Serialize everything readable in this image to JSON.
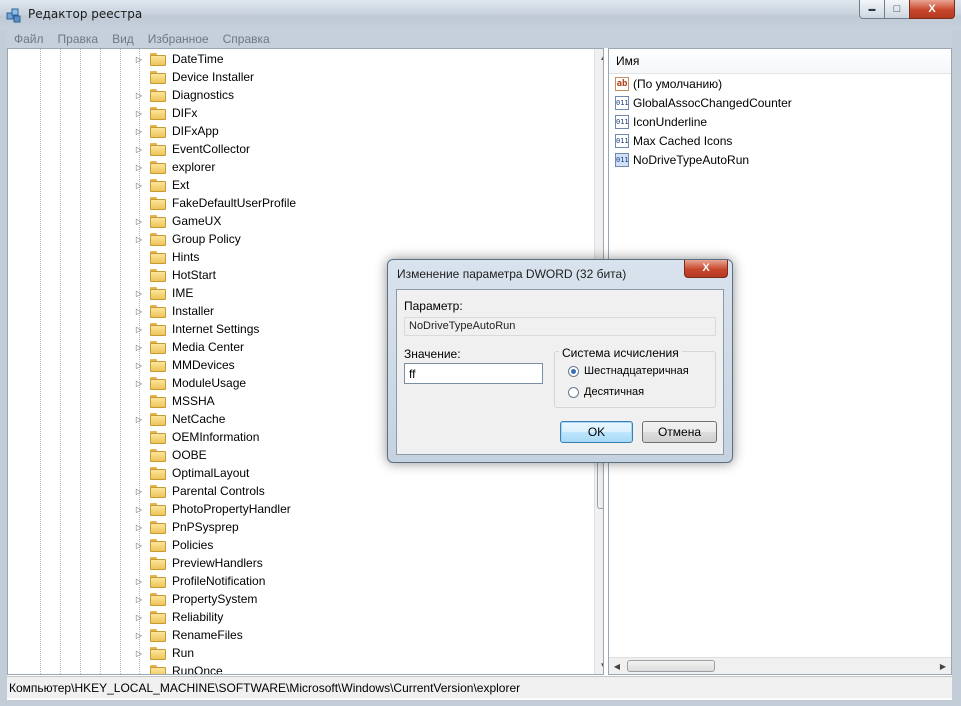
{
  "window": {
    "title": "Редактор реестра",
    "controls": {
      "minimize": "▬",
      "maximize": "□",
      "close": "X"
    }
  },
  "menu": [
    "Файл",
    "Правка",
    "Вид",
    "Избранное",
    "Справка"
  ],
  "tree": {
    "items": [
      {
        "label": "DateTime",
        "expandable": true
      },
      {
        "label": "Device Installer",
        "expandable": false
      },
      {
        "label": "Diagnostics",
        "expandable": true
      },
      {
        "label": "DIFx",
        "expandable": true
      },
      {
        "label": "DIFxApp",
        "expandable": true
      },
      {
        "label": "EventCollector",
        "expandable": true
      },
      {
        "label": "explorer",
        "expandable": true
      },
      {
        "label": "Ext",
        "expandable": true
      },
      {
        "label": "FakeDefaultUserProfile",
        "expandable": false
      },
      {
        "label": "GameUX",
        "expandable": true
      },
      {
        "label": "Group Policy",
        "expandable": true
      },
      {
        "label": "Hints",
        "expandable": false
      },
      {
        "label": "HotStart",
        "expandable": false
      },
      {
        "label": "IME",
        "expandable": true
      },
      {
        "label": "Installer",
        "expandable": true
      },
      {
        "label": "Internet Settings",
        "expandable": true
      },
      {
        "label": "Media Center",
        "expandable": true
      },
      {
        "label": "MMDevices",
        "expandable": true
      },
      {
        "label": "ModuleUsage",
        "expandable": true
      },
      {
        "label": "MSSHA",
        "expandable": false
      },
      {
        "label": "NetCache",
        "expandable": true
      },
      {
        "label": "OEMInformation",
        "expandable": false
      },
      {
        "label": "OOBE",
        "expandable": false
      },
      {
        "label": "OptimalLayout",
        "expandable": false
      },
      {
        "label": "Parental Controls",
        "expandable": true
      },
      {
        "label": "PhotoPropertyHandler",
        "expandable": true
      },
      {
        "label": "PnPSysprep",
        "expandable": true
      },
      {
        "label": "Policies",
        "expandable": true
      },
      {
        "label": "PreviewHandlers",
        "expandable": false
      },
      {
        "label": "ProfileNotification",
        "expandable": true
      },
      {
        "label": "PropertySystem",
        "expandable": true
      },
      {
        "label": "Reliability",
        "expandable": true
      },
      {
        "label": "RenameFiles",
        "expandable": true
      },
      {
        "label": "Run",
        "expandable": true
      },
      {
        "label": "RunOnce",
        "expandable": false
      }
    ]
  },
  "values_pane": {
    "column_header": "Имя",
    "rows": [
      {
        "name": "(По умолчанию)",
        "type": "string",
        "icon": "ab"
      },
      {
        "name": "GlobalAssocChangedCounter",
        "type": "dword",
        "icon": "011"
      },
      {
        "name": "IconUnderline",
        "type": "dword",
        "icon": "011"
      },
      {
        "name": "Max Cached Icons",
        "type": "dword",
        "icon": "011"
      },
      {
        "name": "NoDriveTypeAutoRun",
        "type": "dword",
        "icon": "011",
        "selected": true
      }
    ]
  },
  "statusbar": {
    "path": "Компьютер\\HKEY_LOCAL_MACHINE\\SOFTWARE\\Microsoft\\Windows\\CurrentVersion\\explorer"
  },
  "dialog": {
    "title": "Изменение параметра DWORD (32 бита)",
    "close_label": "X",
    "param_label": "Параметр:",
    "param_value": "NoDriveTypeAutoRun",
    "value_label": "Значение:",
    "value_input": "ff",
    "base_group_title": "Система исчисления",
    "radio_hex": "Шестнадцатеричная",
    "radio_dec": "Десятичная",
    "selected_base": "hex",
    "ok_label": "OK",
    "cancel_label": "Отмена"
  }
}
